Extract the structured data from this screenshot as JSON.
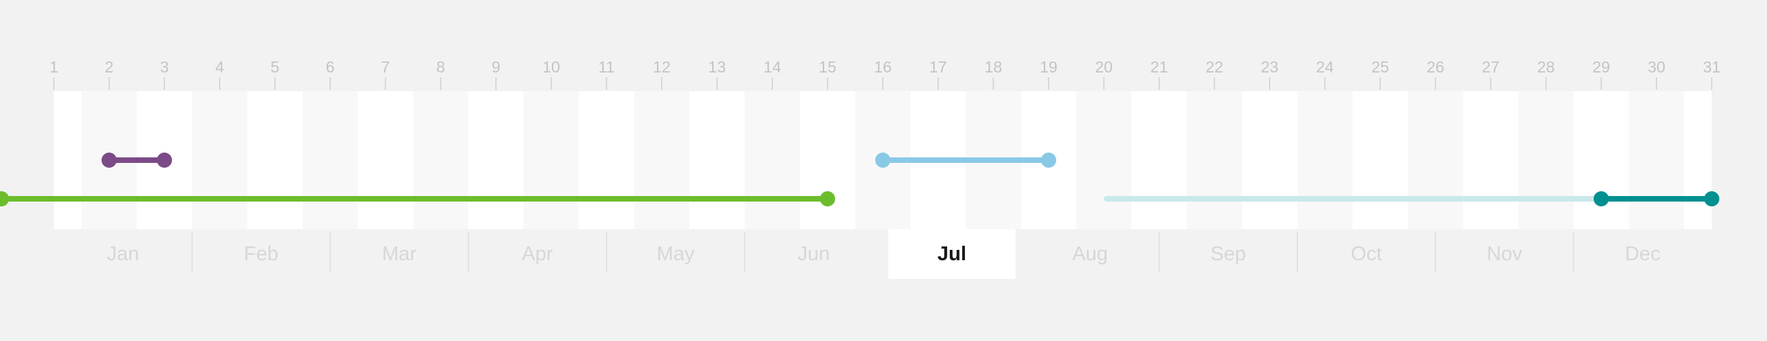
{
  "timeline": {
    "days": [
      1,
      2,
      3,
      4,
      5,
      6,
      7,
      8,
      9,
      10,
      11,
      12,
      13,
      14,
      15,
      16,
      17,
      18,
      19,
      20,
      21,
      22,
      23,
      24,
      25,
      26,
      27,
      28,
      29,
      30,
      31
    ],
    "months": [
      "Jan",
      "Feb",
      "Mar",
      "Apr",
      "May",
      "Jun",
      "Jul",
      "Aug",
      "Sep",
      "Oct",
      "Nov",
      "Dec"
    ],
    "selected_month": "Jul",
    "ranges": [
      {
        "id": "purple",
        "start": 2,
        "end": 3,
        "color": "#7c4a87",
        "start_dot": true,
        "end_dot": true,
        "row": 1
      },
      {
        "id": "light-blue",
        "start": 16,
        "end": 19,
        "color": "#89c9e6",
        "start_dot": true,
        "end_dot": true,
        "row": 1
      },
      {
        "id": "green",
        "start": 0.05,
        "end": 15,
        "color": "#6cbd2b",
        "start_dot": true,
        "end_dot": true,
        "row": 2
      },
      {
        "id": "pale-teal",
        "start": 20,
        "end": 29,
        "color": "#c9e8ea",
        "start_dot": false,
        "end_dot": false,
        "row": 2
      },
      {
        "id": "teal",
        "start": 29,
        "end": 31,
        "color": "#009090",
        "start_dot": true,
        "end_dot": true,
        "row": 2
      }
    ]
  }
}
